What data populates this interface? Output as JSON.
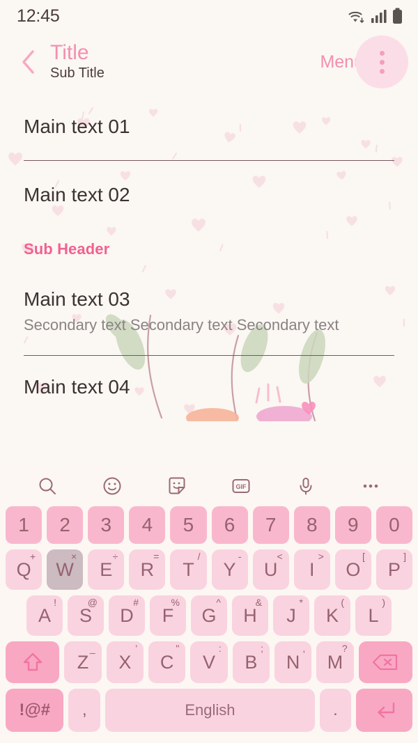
{
  "status_bar": {
    "time": "12:45",
    "icons": [
      "wifi-icon",
      "signal-icon",
      "battery-icon"
    ]
  },
  "app_bar": {
    "back_icon": "chevron-left-icon",
    "title": "Title",
    "subtitle": "Sub Title",
    "menu_label": "Menu",
    "overflow_icon": "more-vertical-icon"
  },
  "list": {
    "items": [
      {
        "main": "Main text 01",
        "secondary": "",
        "divider_after": true
      },
      {
        "main": "Main text 02",
        "secondary": "",
        "divider_after": false
      }
    ],
    "sub_header": "Sub Header",
    "items2": [
      {
        "main": "Main text 03",
        "secondary": "Secondary text Secondary text Secondary text",
        "divider_after": true
      },
      {
        "main": "Main text 04",
        "secondary": "",
        "divider_after": false
      }
    ]
  },
  "keyboard": {
    "toolbar": [
      {
        "name": "search-icon"
      },
      {
        "name": "emoji-icon"
      },
      {
        "name": "sticker-icon"
      },
      {
        "name": "gif-icon",
        "label": "GIF"
      },
      {
        "name": "microphone-icon"
      },
      {
        "name": "more-horizontal-icon"
      }
    ],
    "number_row": [
      "1",
      "2",
      "3",
      "4",
      "5",
      "6",
      "7",
      "8",
      "9",
      "0"
    ],
    "row_q": [
      {
        "key": "Q",
        "sup": "+"
      },
      {
        "key": "W",
        "sup": "×",
        "pressed": true
      },
      {
        "key": "E",
        "sup": "÷"
      },
      {
        "key": "R",
        "sup": "="
      },
      {
        "key": "T",
        "sup": "/"
      },
      {
        "key": "Y",
        "sup": "-"
      },
      {
        "key": "U",
        "sup": "<"
      },
      {
        "key": "I",
        "sup": ">"
      },
      {
        "key": "O",
        "sup": "["
      },
      {
        "key": "P",
        "sup": "]"
      }
    ],
    "row_a": [
      {
        "key": "A",
        "sup": "!"
      },
      {
        "key": "S",
        "sup": "@"
      },
      {
        "key": "D",
        "sup": "#"
      },
      {
        "key": "F",
        "sup": "%"
      },
      {
        "key": "G",
        "sup": "^"
      },
      {
        "key": "H",
        "sup": "&"
      },
      {
        "key": "J",
        "sup": "*"
      },
      {
        "key": "K",
        "sup": "("
      },
      {
        "key": "L",
        "sup": ")"
      }
    ],
    "row_z": [
      {
        "key": "Z",
        "sup": "_"
      },
      {
        "key": "X",
        "sup": "'"
      },
      {
        "key": "C",
        "sup": "\""
      },
      {
        "key": "V",
        "sup": ":"
      },
      {
        "key": "B",
        "sup": ";"
      },
      {
        "key": "N",
        "sup": ","
      },
      {
        "key": "M",
        "sup": "?"
      }
    ],
    "shift_icon": "shift-arrow-up-icon",
    "backspace_icon": "backspace-icon",
    "symbols_label": "!@#",
    "comma_label": ",",
    "space_label": "English",
    "period_label": ".",
    "enter_icon": "enter-return-icon"
  },
  "colors": {
    "background": "#FBF7F2",
    "accent_pink": "#F48FB1",
    "sub_header_pink": "#F06292",
    "key_light": "#FAD3E0",
    "key_number": "#F9B7CD",
    "key_accent": "#F9A8C4",
    "key_pressed": "#CCBBC1",
    "key_text": "#96626F",
    "text_primary": "#3B3232",
    "text_secondary": "#8A8385",
    "divider": "#7A5560"
  }
}
